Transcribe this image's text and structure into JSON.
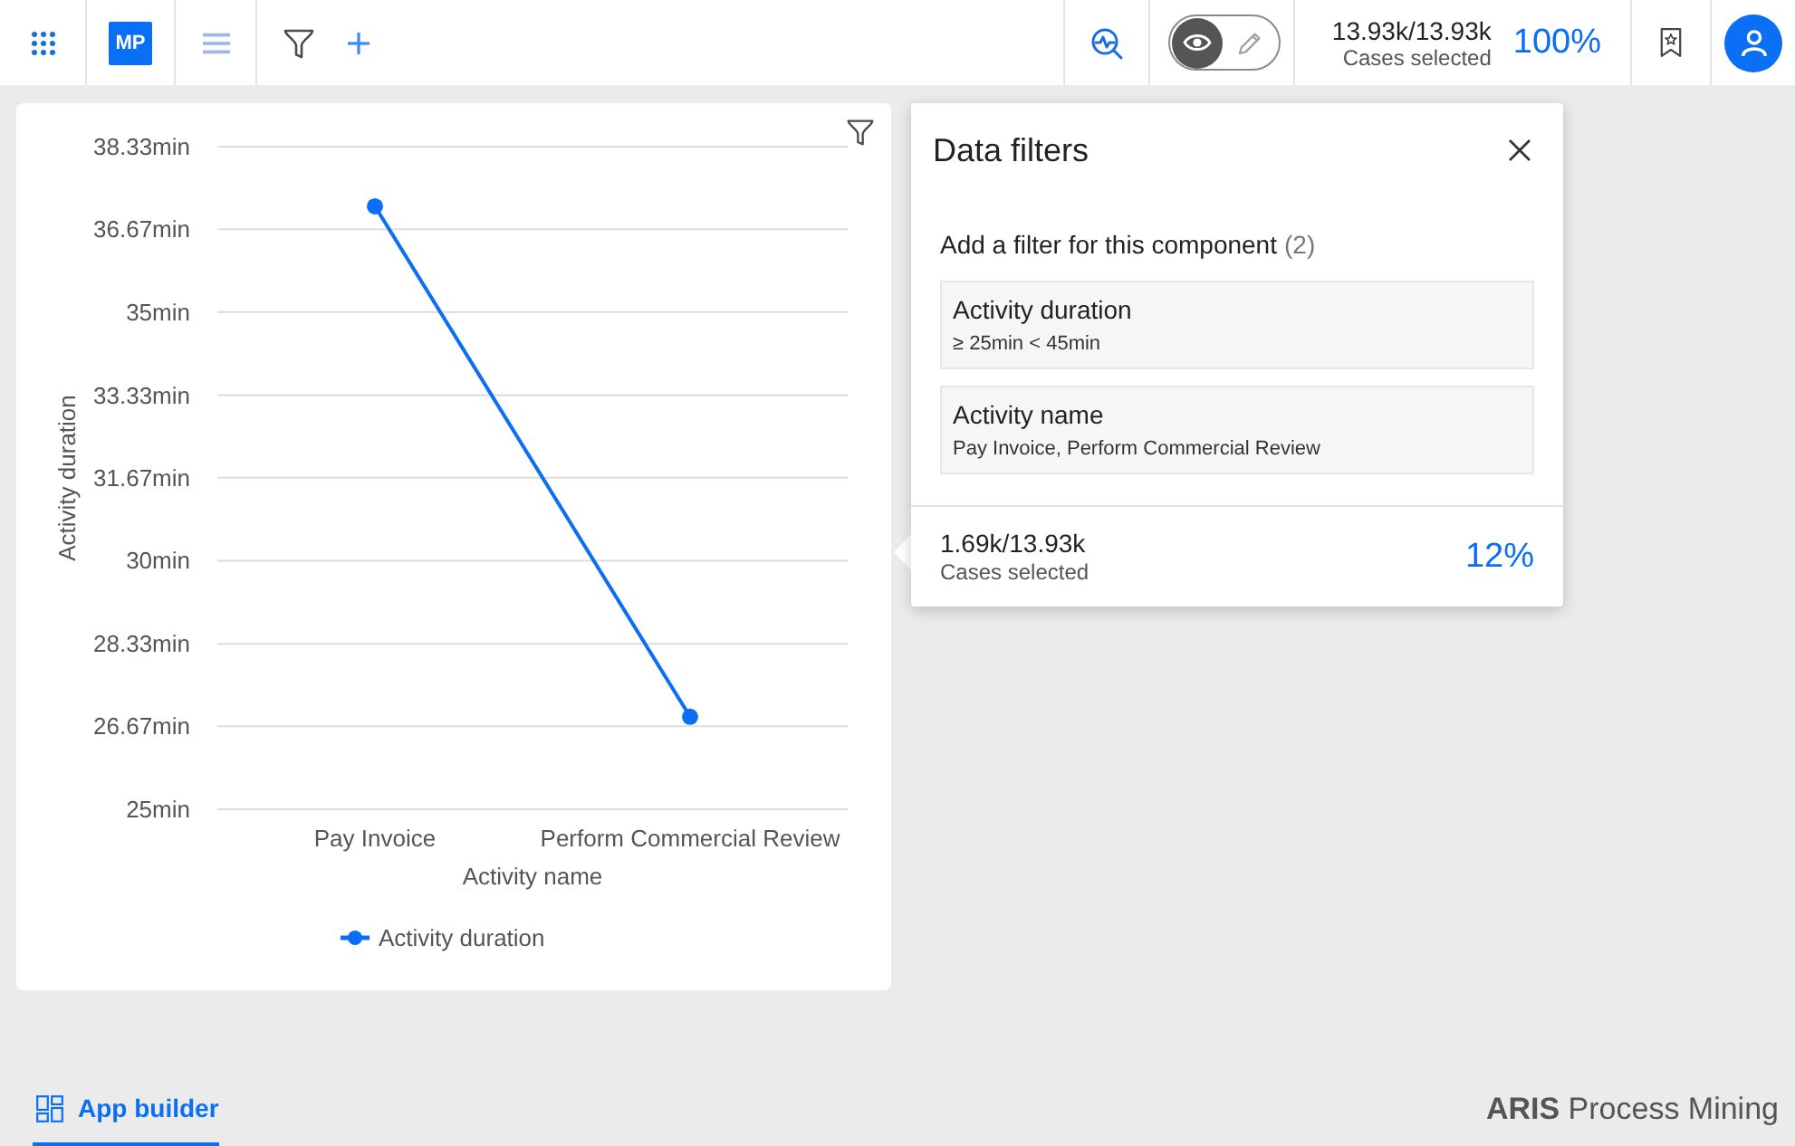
{
  "top_bar": {
    "app_badge": "MP",
    "mode_toggle": [
      {
        "kind": "view",
        "selected": true
      },
      {
        "kind": "edit",
        "selected": false
      }
    ],
    "cases": {
      "count": "13.93k/13.93k",
      "label": "Cases selected",
      "percent": "100%"
    }
  },
  "chart_card": {
    "chart_data": {
      "type": "line",
      "grid": true,
      "xlabel": "Activity name",
      "ylabel": "Activity duration",
      "categories": [
        "Pay Invoice",
        "Perform Commercial Review"
      ],
      "series": [
        {
          "name": "Activity duration",
          "color": "#0b6ff5",
          "marker": "circle",
          "values": [
            37.13,
            26.86
          ]
        }
      ],
      "ylim": [
        25,
        38.33
      ],
      "yticks": [
        {
          "value": 25,
          "label": "25min"
        },
        {
          "value": 26.67,
          "label": "26.67min"
        },
        {
          "value": 28.33,
          "label": "28.33min"
        },
        {
          "value": 30,
          "label": "30min"
        },
        {
          "value": 31.67,
          "label": "31.67min"
        },
        {
          "value": 33.33,
          "label": "33.33min"
        },
        {
          "value": 35,
          "label": "35min"
        },
        {
          "value": 36.67,
          "label": "36.67min"
        },
        {
          "value": 38.33,
          "label": "38.33min"
        }
      ]
    }
  },
  "data_filters": {
    "title": "Data filters",
    "subtitle": "Add a filter for this component",
    "count": "(2)",
    "filters": [
      {
        "name": "Activity duration",
        "value": "≥ 25min < 45min"
      },
      {
        "name": "Activity name",
        "value": "Pay Invoice, Perform Commercial Review"
      }
    ],
    "selection": {
      "count": "1.69k/13.93k",
      "label": "Cases selected",
      "percent": "12%"
    }
  },
  "bottom_bar": {
    "tabs": [
      {
        "label": "App builder",
        "selected": true
      }
    ],
    "brand": "**ARIS** Process Mining"
  }
}
